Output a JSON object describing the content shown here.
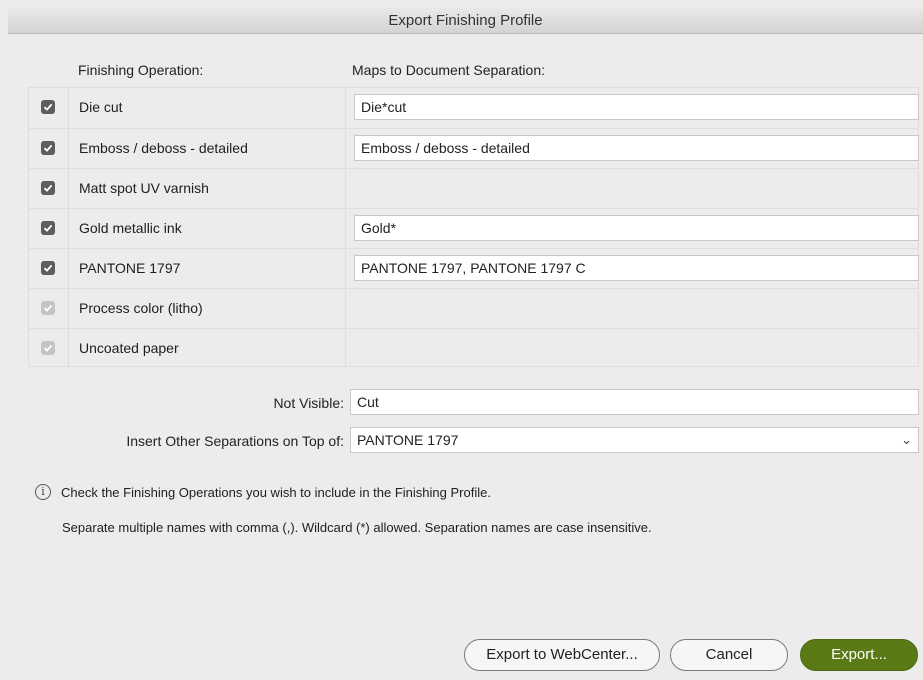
{
  "window": {
    "title": "Export Finishing Profile"
  },
  "headers": {
    "operation": "Finishing Operation:",
    "separation": "Maps to Document Separation:"
  },
  "rows": [
    {
      "label": "Die cut",
      "checked": true,
      "enabled": true,
      "separation": "Die*cut"
    },
    {
      "label": "Emboss / deboss - detailed",
      "checked": true,
      "enabled": true,
      "separation": "Emboss / deboss - detailed"
    },
    {
      "label": "Matt spot UV varnish",
      "checked": true,
      "enabled": true,
      "separation": ""
    },
    {
      "label": "Gold metallic ink",
      "checked": true,
      "enabled": true,
      "separation": "Gold*"
    },
    {
      "label": "PANTONE 1797",
      "checked": true,
      "enabled": true,
      "separation": "PANTONE 1797, PANTONE 1797 C"
    },
    {
      "label": "Process color (litho)",
      "checked": true,
      "enabled": false,
      "separation": ""
    },
    {
      "label": "Uncoated paper",
      "checked": true,
      "enabled": false,
      "separation": ""
    }
  ],
  "not_visible": {
    "label": "Not Visible:",
    "value": "Cut"
  },
  "insert_on_top": {
    "label": "Insert Other Separations on Top of:",
    "value": "PANTONE 1797"
  },
  "info_text": "Check the Finishing Operations you wish to include in the Finishing Profile.",
  "note_text": "Separate multiple names with comma (,). Wildcard (*) allowed. Separation names are case insensitive.",
  "buttons": {
    "export_webcenter": "Export to WebCenter...",
    "cancel": "Cancel",
    "export": "Export..."
  },
  "icons": {
    "checkbox": "checkmark-icon",
    "info": "info-icon",
    "dropdown": "chevron-down-icon"
  },
  "colors": {
    "primary_button": "#5a7a16",
    "checkbox_on": "#5d5d5d",
    "checkbox_disabled": "#c4c4c4"
  }
}
